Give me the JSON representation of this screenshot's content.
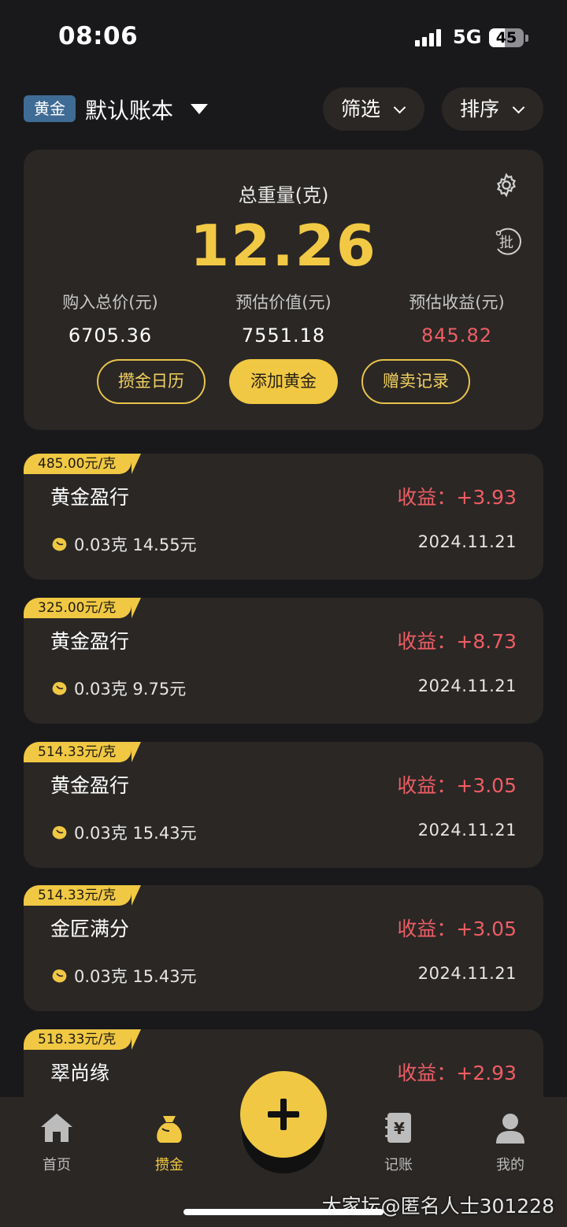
{
  "status_bar": {
    "time": "08:06",
    "network": "5G",
    "battery": "45",
    "battery_level": 0.45
  },
  "header": {
    "tag": "黄金",
    "book_title": "默认账本",
    "filter_label": "筛选",
    "sort_label": "排序"
  },
  "summary": {
    "title": "总重量(克)",
    "total_weight": "12.26",
    "batch_icon_text": "批",
    "stats": [
      {
        "label": "购入总价(元)",
        "value": "6705.36"
      },
      {
        "label": "预估价值(元)",
        "value": "7551.18"
      },
      {
        "label": "预估收益(元)",
        "value": "845.82"
      }
    ],
    "buttons": {
      "calendar": "攒金日历",
      "add": "添加黄金",
      "gift_sell": "赠卖记录"
    }
  },
  "cards": [
    {
      "price": "485.00元/克",
      "name": "黄金盈行",
      "profit": "收益：+3.93",
      "detail": "0.03克 14.55元",
      "date": "2024.11.21"
    },
    {
      "price": "325.00元/克",
      "name": "黄金盈行",
      "profit": "收益：+8.73",
      "detail": "0.03克 9.75元",
      "date": "2024.11.21"
    },
    {
      "price": "514.33元/克",
      "name": "黄金盈行",
      "profit": "收益：+3.05",
      "detail": "0.03克 15.43元",
      "date": "2024.11.21"
    },
    {
      "price": "514.33元/克",
      "name": "金匠满分",
      "profit": "收益：+3.05",
      "detail": "0.03克 15.43元",
      "date": "2024.11.21"
    },
    {
      "price": "518.33元/克",
      "name": "翠尚缘",
      "profit": "收益：+2.93",
      "detail": "",
      "date": ""
    }
  ],
  "tabbar": {
    "home": "首页",
    "save": "攒金",
    "book": "记账",
    "mine": "我的",
    "book_icon_glyph": "¥"
  },
  "watermark": "大家坛@匿名人士301228",
  "colors": {
    "gold": "#f0c843",
    "profit_red": "#ee5d63",
    "card_bg": "#2a2725",
    "page_bg": "#19191b",
    "tag_blue": "#3f6c95"
  }
}
